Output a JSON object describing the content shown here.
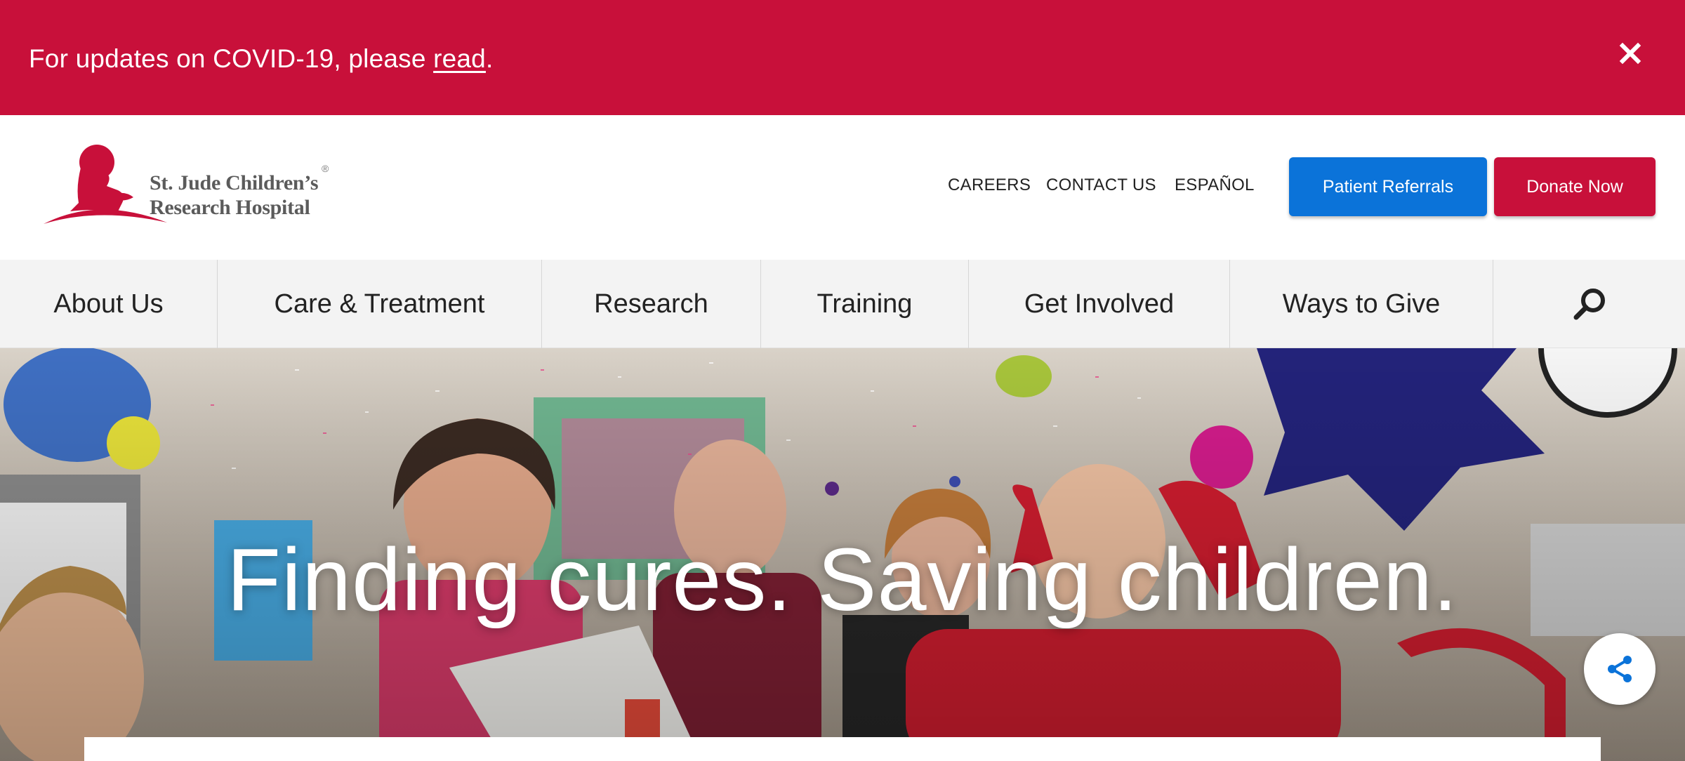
{
  "alert": {
    "text_before": "For updates on COVID-19, please ",
    "link_text": "read",
    "text_after": ".",
    "close_icon": "close-icon"
  },
  "header": {
    "logo_line1": "St. Jude Children’s",
    "logo_line2": "Research Hospital",
    "logo_reg": "®",
    "utility_links": [
      "CAREERS",
      "CONTACT US",
      "ESPAÑOL"
    ],
    "patient_referrals_label": "Patient Referrals",
    "donate_label": "Donate Now"
  },
  "nav": {
    "items": [
      "About Us",
      "Care & Treatment",
      "Research",
      "Training",
      "Get Involved",
      "Ways to Give"
    ],
    "search_icon": "search-icon"
  },
  "hero": {
    "title": "Finding cures. Saving children.",
    "share_icon": "share-icon"
  },
  "colors": {
    "brand_red": "#c8103a",
    "referral_blue": "#0b73d9",
    "nav_bg": "#f3f3f3"
  }
}
